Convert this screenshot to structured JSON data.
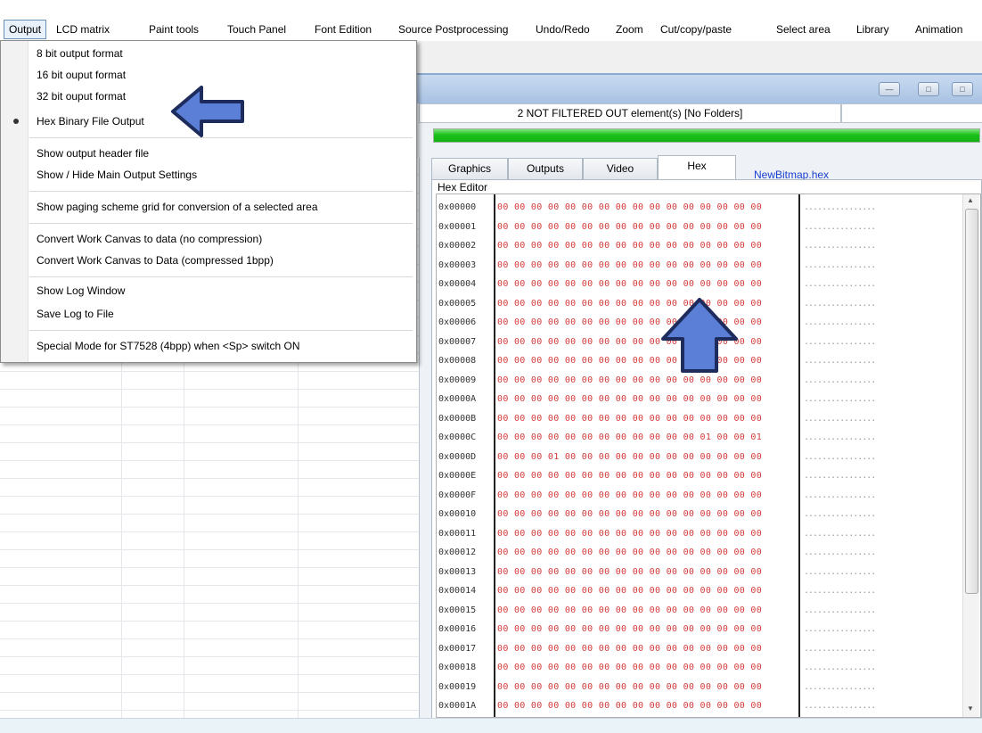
{
  "menubar": {
    "items": [
      {
        "label": "Output"
      },
      {
        "label": "LCD matrix"
      },
      {
        "label": "Paint tools"
      },
      {
        "label": "Touch Panel"
      },
      {
        "label": "Font Edition"
      },
      {
        "label": "Source Postprocessing"
      },
      {
        "label": "Undo/Redo"
      },
      {
        "label": "Zoom"
      },
      {
        "label": "Cut/copy/paste"
      },
      {
        "label": "Select area"
      },
      {
        "label": "Library"
      },
      {
        "label": "Animation"
      }
    ]
  },
  "output_menu": {
    "items": [
      {
        "label": "8 bit output format"
      },
      {
        "label": "16 bit ouput format"
      },
      {
        "label": "32 bit ouput format"
      },
      {
        "label": "Hex Binary File Output",
        "checked": true
      },
      {
        "label": "Show output header file"
      },
      {
        "label": "Show / Hide Main Output  Settings"
      },
      {
        "label": "Show paging scheme grid for conversion of a selected area"
      },
      {
        "label": "Convert Work Canvas to data (no compression)"
      },
      {
        "label": "Convert Work Canvas to Data (compressed 1bpp)"
      },
      {
        "label": "Show Log Window"
      },
      {
        "label": "Save Log to File"
      },
      {
        "label": "Special Mode for ST7528 (4bpp) when <Sp> switch ON"
      }
    ]
  },
  "status": {
    "text": "2 NOT FILTERED OUT element(s) [No Folders]",
    "progress": 1.0
  },
  "tabs": [
    {
      "label": "Graphics"
    },
    {
      "label": "Outputs"
    },
    {
      "label": "Video"
    },
    {
      "label": "Hex",
      "active": true
    }
  ],
  "filename": "NewBitmap.hex",
  "hex_editor": {
    "label": "Hex Editor",
    "rows": [
      {
        "addr": "0x00000",
        "bytes": "00 00 00 00 00 00 00 00 00 00 00 00 00 00 00 00",
        "ascii": "................"
      },
      {
        "addr": "0x00001",
        "bytes": "00 00 00 00 00 00 00 00 00 00 00 00 00 00 00 00",
        "ascii": "................"
      },
      {
        "addr": "0x00002",
        "bytes": "00 00 00 00 00 00 00 00 00 00 00 00 00 00 00 00",
        "ascii": "................"
      },
      {
        "addr": "0x00003",
        "bytes": "00 00 00 00 00 00 00 00 00 00 00 00 00 00 00 00",
        "ascii": "................"
      },
      {
        "addr": "0x00004",
        "bytes": "00 00 00 00 00 00 00 00 00 00 00 00 00 00 00 00",
        "ascii": "................"
      },
      {
        "addr": "0x00005",
        "bytes": "00 00 00 00 00 00 00 00 00 00 00 00 00 00 00 00",
        "ascii": "................"
      },
      {
        "addr": "0x00006",
        "bytes": "00 00 00 00 00 00 00 00 00 00 00 00 00 00 00 00",
        "ascii": "................"
      },
      {
        "addr": "0x00007",
        "bytes": "00 00 00 00 00 00 00 00 00 00 00 00 00 00 00 00",
        "ascii": "................"
      },
      {
        "addr": "0x00008",
        "bytes": "00 00 00 00 00 00 00 00 00 00 00 00 00 00 00 00",
        "ascii": "................"
      },
      {
        "addr": "0x00009",
        "bytes": "00 00 00 00 00 00 00 00 00 00 00 00 00 00 00 00",
        "ascii": "................"
      },
      {
        "addr": "0x0000A",
        "bytes": "00 00 00 00 00 00 00 00 00 00 00 00 00 00 00 00",
        "ascii": "................"
      },
      {
        "addr": "0x0000B",
        "bytes": "00 00 00 00 00 00 00 00 00 00 00 00 00 00 00 00",
        "ascii": "................"
      },
      {
        "addr": "0x0000C",
        "bytes": "00 00 00 00 00 00 00 00 00 00 00 00 01 00 00 01",
        "ascii": "................"
      },
      {
        "addr": "0x0000D",
        "bytes": "00 00 00 01 00 00 00 00 00 00 00 00 00 00 00 00",
        "ascii": "................"
      },
      {
        "addr": "0x0000E",
        "bytes": "00 00 00 00 00 00 00 00 00 00 00 00 00 00 00 00",
        "ascii": "................"
      },
      {
        "addr": "0x0000F",
        "bytes": "00 00 00 00 00 00 00 00 00 00 00 00 00 00 00 00",
        "ascii": "................"
      },
      {
        "addr": "0x00010",
        "bytes": "00 00 00 00 00 00 00 00 00 00 00 00 00 00 00 00",
        "ascii": "................"
      },
      {
        "addr": "0x00011",
        "bytes": "00 00 00 00 00 00 00 00 00 00 00 00 00 00 00 00",
        "ascii": "................"
      },
      {
        "addr": "0x00012",
        "bytes": "00 00 00 00 00 00 00 00 00 00 00 00 00 00 00 00",
        "ascii": "................"
      },
      {
        "addr": "0x00013",
        "bytes": "00 00 00 00 00 00 00 00 00 00 00 00 00 00 00 00",
        "ascii": "................"
      },
      {
        "addr": "0x00014",
        "bytes": "00 00 00 00 00 00 00 00 00 00 00 00 00 00 00 00",
        "ascii": "................"
      },
      {
        "addr": "0x00015",
        "bytes": "00 00 00 00 00 00 00 00 00 00 00 00 00 00 00 00",
        "ascii": "................"
      },
      {
        "addr": "0x00016",
        "bytes": "00 00 00 00 00 00 00 00 00 00 00 00 00 00 00 00",
        "ascii": "................"
      },
      {
        "addr": "0x00017",
        "bytes": "00 00 00 00 00 00 00 00 00 00 00 00 00 00 00 00",
        "ascii": "................"
      },
      {
        "addr": "0x00018",
        "bytes": "00 00 00 00 00 00 00 00 00 00 00 00 00 00 00 00",
        "ascii": "................"
      },
      {
        "addr": "0x00019",
        "bytes": "00 00 00 00 00 00 00 00 00 00 00 00 00 00 00 00",
        "ascii": "................"
      },
      {
        "addr": "0x0001A",
        "bytes": "00 00 00 00 00 00 00 00 00 00 00 00 00 00 00 00",
        "ascii": "................"
      }
    ]
  },
  "annotation_arrows": [
    {
      "direction": "left",
      "color": "#5b7fd6"
    },
    {
      "direction": "up",
      "color": "#5b7fd6"
    }
  ],
  "icons": {
    "minimize": "minimize-icon",
    "restore": "restore-icon",
    "close": "close-icon",
    "scroll_up": "scroll-up-icon",
    "scroll_down": "scroll-down-icon"
  },
  "colors": {
    "hex_bytes": "#d43a3a",
    "progress": "#19c119",
    "link": "#1a3fcf"
  }
}
